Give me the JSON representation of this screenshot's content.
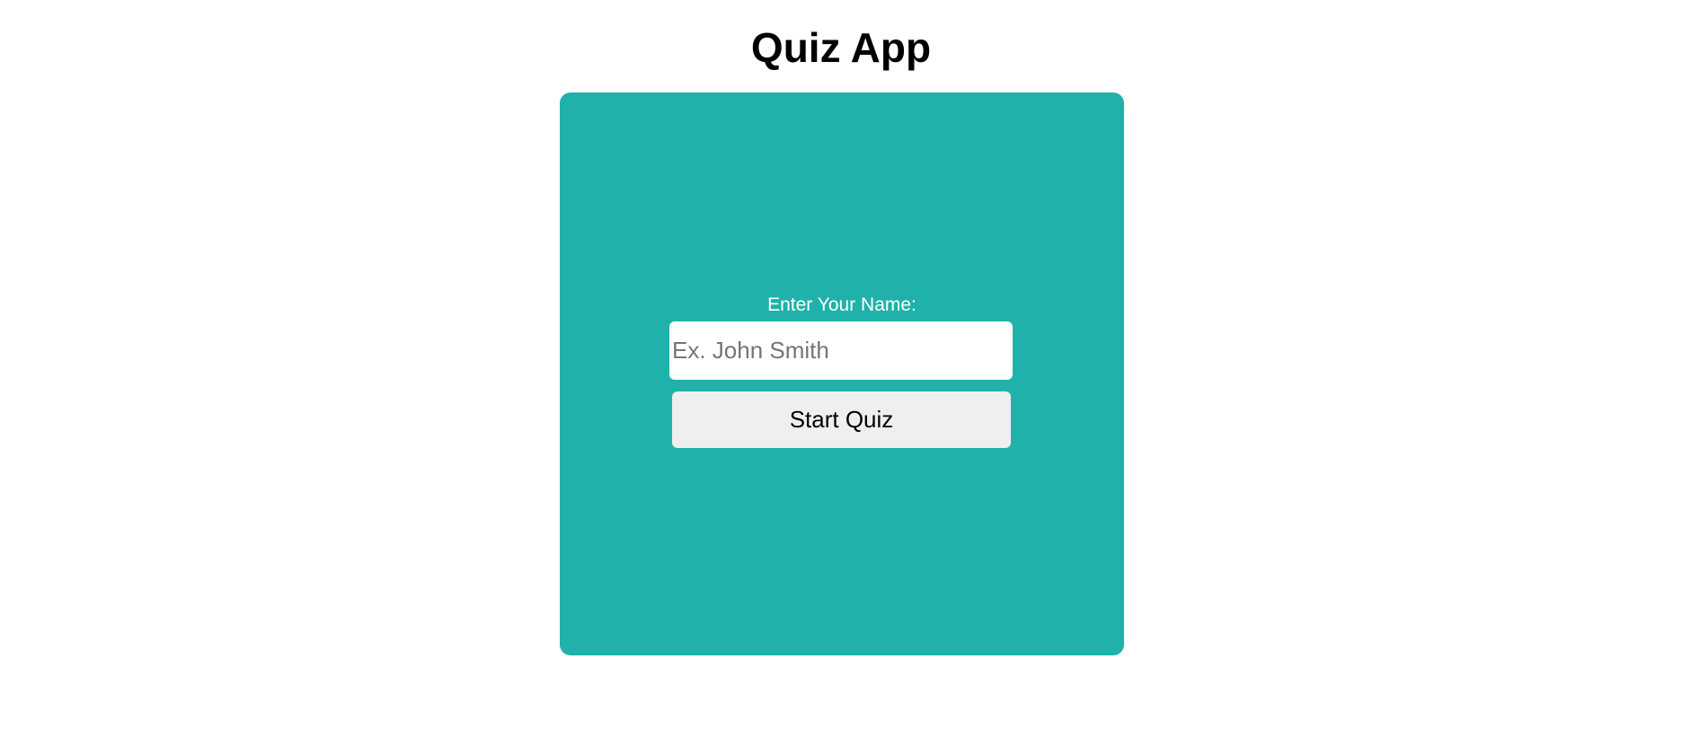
{
  "header": {
    "title": "Quiz App"
  },
  "card": {
    "background_color": "#20b2aa",
    "name_label": "Enter Your Name:",
    "name_input": {
      "value": "",
      "placeholder": "Ex. John Smith"
    },
    "start_button_label": "Start Quiz"
  }
}
